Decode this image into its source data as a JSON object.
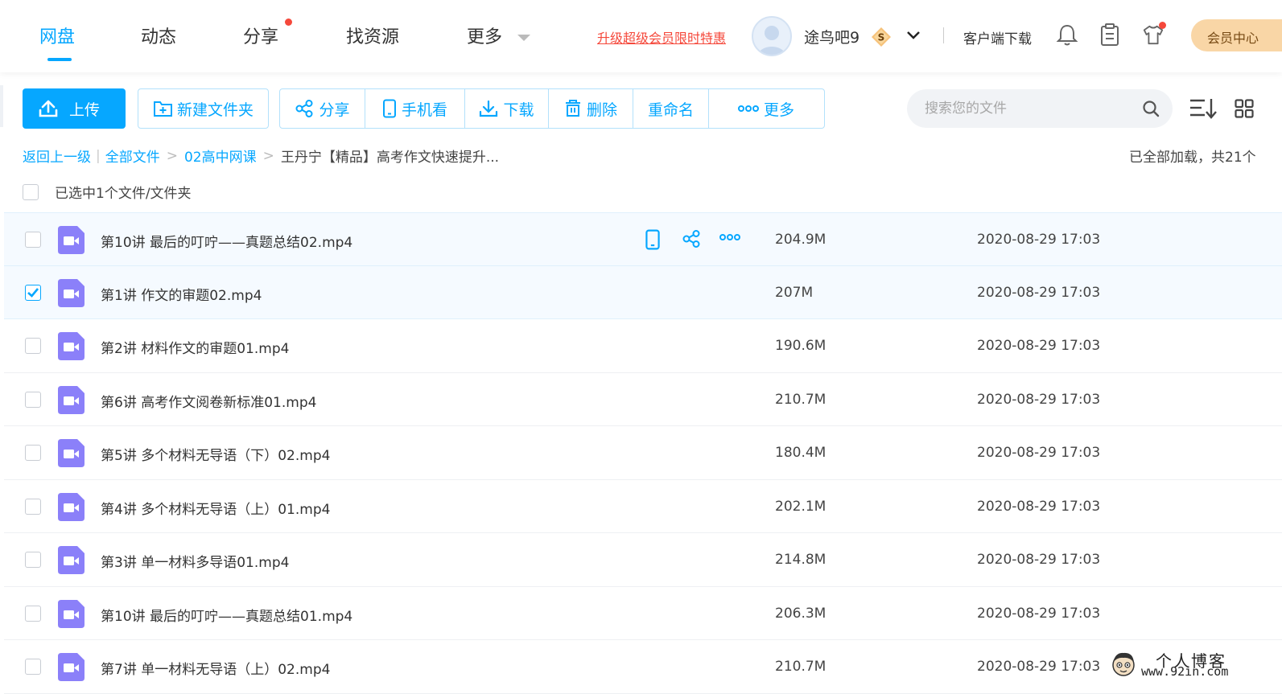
{
  "nav": {
    "items": [
      {
        "label": "网盘",
        "active": true
      },
      {
        "label": "动态",
        "active": false
      },
      {
        "label": "分享",
        "active": false,
        "has_dot": true
      },
      {
        "label": "找资源",
        "active": false
      },
      {
        "label": "更多",
        "active": false,
        "has_caret": true
      }
    ]
  },
  "header": {
    "promo_link": "升级超级会员限时特惠",
    "username": "途鸟吧9",
    "vip_badge": "S",
    "client_download": "客户端下载",
    "member_center": "会员中心",
    "icons": [
      "bell-icon",
      "clipboard-icon",
      "tshirt-icon"
    ]
  },
  "toolbar": {
    "upload": "上传",
    "new_folder": "新建文件夹",
    "share": "分享",
    "phone_view": "手机看",
    "download": "下载",
    "delete": "删除",
    "rename": "重命名",
    "more": "更多",
    "search_placeholder": "搜索您的文件"
  },
  "breadcrumb": {
    "back": "返回上一级",
    "all_files": "全部文件",
    "folder": "02高中网课",
    "current": "王丹宁【精品】高考作文快速提升...",
    "load_status": "已全部加载，共21个"
  },
  "selection": {
    "label": "已选中1个文件/文件夹"
  },
  "files": [
    {
      "name": "第10讲 最后的叮咛——真题总结02.mp4",
      "size": "204.9M",
      "date": "2020-08-29 17:03",
      "checked": false,
      "hover": true
    },
    {
      "name": "第1讲 作文的审题02.mp4",
      "size": "207M",
      "date": "2020-08-29 17:03",
      "checked": true,
      "hover": false
    },
    {
      "name": "第2讲 材料作文的审题01.mp4",
      "size": "190.6M",
      "date": "2020-08-29 17:03",
      "checked": false,
      "hover": false
    },
    {
      "name": "第6讲 高考作文阅卷新标准01.mp4",
      "size": "210.7M",
      "date": "2020-08-29 17:03",
      "checked": false,
      "hover": false
    },
    {
      "name": "第5讲 多个材料无导语（下）02.mp4",
      "size": "180.4M",
      "date": "2020-08-29 17:03",
      "checked": false,
      "hover": false
    },
    {
      "name": "第4讲 多个材料无导语（上）01.mp4",
      "size": "202.1M",
      "date": "2020-08-29 17:03",
      "checked": false,
      "hover": false
    },
    {
      "name": "第3讲 单一材料多导语01.mp4",
      "size": "214.8M",
      "date": "2020-08-29 17:03",
      "checked": false,
      "hover": false
    },
    {
      "name": "第10讲 最后的叮咛——真题总结01.mp4",
      "size": "206.3M",
      "date": "2020-08-29 17:03",
      "checked": false,
      "hover": false
    },
    {
      "name": "第7讲 单一材料无导语（上）02.mp4",
      "size": "210.7M",
      "date": "2020-08-29 17:03",
      "checked": false,
      "hover": false
    }
  ],
  "watermark": {
    "title": "个人博客",
    "url": "www.92in.com"
  },
  "colors": {
    "accent": "#06a7ff",
    "promo": "#f5483b",
    "video_icon": "#8b80f9",
    "member_bg": "#f9d6a6"
  }
}
